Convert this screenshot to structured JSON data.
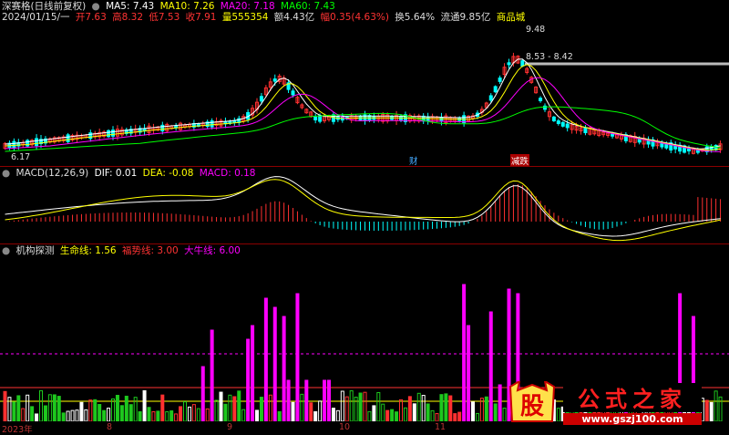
{
  "main_header": {
    "row1": {
      "title": "深赛格(日线前复权)",
      "ma5": "MA5: 7.43",
      "ma10": "MA10: 7.26",
      "ma20": "MA20: 7.18",
      "ma60": "MA60: 7.43"
    },
    "row2": {
      "date": "2024/01/15/一",
      "open": "开7.63",
      "high": "高8.32",
      "low": "低7.53",
      "close": "收7.91",
      "volume": "量555354",
      "amount": "额4.43亿",
      "change": "幅0.35(4.63%)",
      "turnover": "换5.64%",
      "float": "流通9.85亿",
      "industry": "商品城"
    }
  },
  "price_labels": {
    "high_mark": "9.48",
    "range": "8.53 - 8.42",
    "low_mark": "6.17",
    "tag_cai": "财",
    "tag_jiao": "减跌"
  },
  "macd_header": {
    "name": "MACD(12,26,9)",
    "dif": "DIF: 0.01",
    "dea": "DEA: -0.08",
    "macd": "MACD: 0.18"
  },
  "inst_header": {
    "name": "机构探测",
    "life": "生命线: 1.56",
    "bull": "福势线: 3.00",
    "big_bull": "大牛线: 6.00"
  },
  "x_axis": [
    "2023年",
    "8",
    "9",
    "10",
    "11"
  ],
  "watermark": {
    "glyph": "股",
    "brand": "公式之家",
    "url": "www.gszj100.com"
  },
  "colors": {
    "up": "#ff3030",
    "down": "#00ffff",
    "ma5": "#ffffff",
    "ma10": "#ffff00",
    "ma20": "#ff00ff",
    "ma60": "#00ff00",
    "inst_bar": "#ff00ff"
  }
}
